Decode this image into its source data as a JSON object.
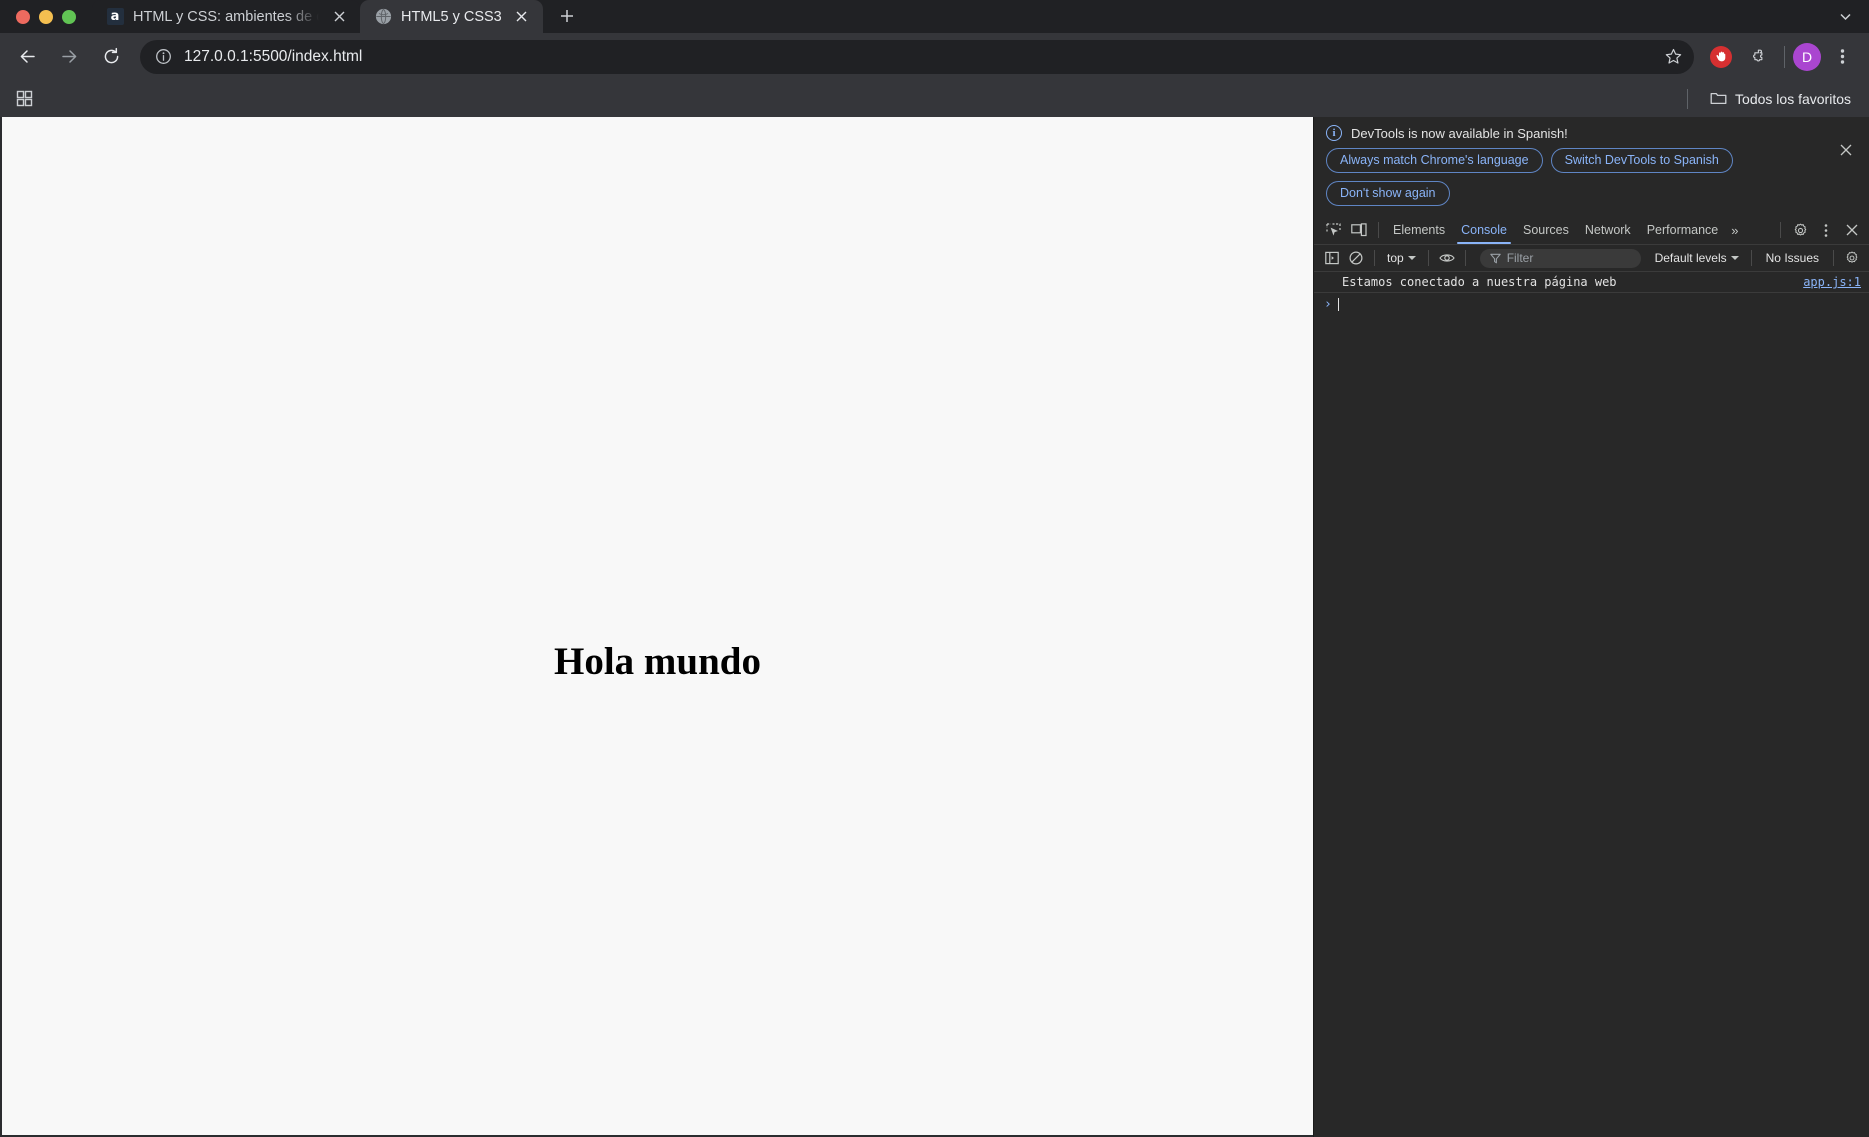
{
  "window": {
    "traffic_lights": [
      "close",
      "minimize",
      "zoom"
    ]
  },
  "tabstrip": {
    "tabs": [
      {
        "title": "HTML y CSS: ambientes de d",
        "favicon": "amazon-a-icon",
        "active": false,
        "close_label": "×"
      },
      {
        "title": "HTML5 y CSS3",
        "favicon": "globe-icon",
        "active": true,
        "close_label": "×"
      }
    ],
    "new_tab_label": "+",
    "tab_search_label": "⌄"
  },
  "toolbar": {
    "back_label": "←",
    "forward_label": "→",
    "reload_label": "⟳",
    "site_info_icon": "info-circle-icon",
    "url": "127.0.0.1:5500/index.html",
    "bookmark_star_icon": "star-icon",
    "adblock_icon": "adblock-hand-icon",
    "extensions_icon": "puzzle-piece-icon",
    "profile_initial": "D",
    "menu_icon": "kebab-menu-icon"
  },
  "bookmarks_bar": {
    "apps_icon": "apps-grid-icon",
    "all_bookmarks_label": "Todos los favoritos",
    "folder_icon": "folder-icon"
  },
  "page": {
    "heading": "Hola mundo",
    "background": "#f8f8f8"
  },
  "devtools": {
    "banner": {
      "info_icon": "info-circle-icon",
      "message": "DevTools is now available in Spanish!",
      "buttons": [
        "Always match Chrome's language",
        "Switch DevTools to Spanish",
        "Don't show again"
      ],
      "close_label": "✕"
    },
    "tabbar": {
      "inspect_icon": "inspect-cursor-icon",
      "device_toolbar_icon": "device-toolbar-icon",
      "tabs": [
        {
          "label": "Elements",
          "active": false
        },
        {
          "label": "Console",
          "active": true
        },
        {
          "label": "Sources",
          "active": false
        },
        {
          "label": "Network",
          "active": false
        },
        {
          "label": "Performance",
          "active": false
        }
      ],
      "overflow_label": "»",
      "settings_icon": "gear-icon",
      "more_icon": "kebab-menu-icon",
      "close_label": "✕"
    },
    "console_toolbar": {
      "sidebar_icon": "console-sidebar-icon",
      "clear_icon": "clear-console-icon",
      "context_value": "top",
      "eye_icon": "live-expression-eye-icon",
      "filter_icon": "filter-funnel-icon",
      "filter_placeholder": "Filter",
      "filter_value": "",
      "levels_value": "Default levels",
      "issues_label": "No Issues",
      "settings_icon": "gear-icon"
    },
    "console": {
      "messages": [
        {
          "text": "Estamos conectado a nuestra página web",
          "source": "app.js:1"
        }
      ],
      "prompt_symbol": "›"
    }
  },
  "colors": {
    "chrome_bg": "#202124",
    "toolbar_bg": "#35363a",
    "devtools_bg": "#282828",
    "accent_blue": "#8ab4f8",
    "avatar_purple": "#aa46d0",
    "adblock_red": "#d63031"
  }
}
